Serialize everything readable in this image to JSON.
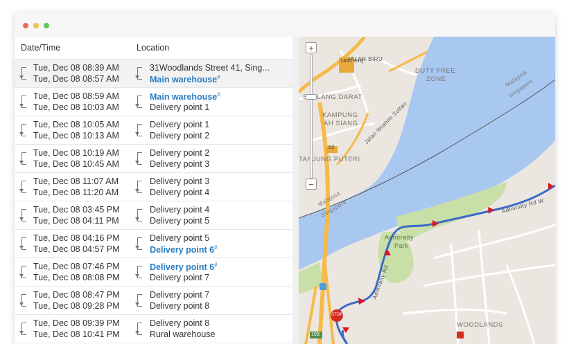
{
  "table": {
    "headers": {
      "datetime": "Date/Time",
      "location": "Location"
    },
    "rows": [
      {
        "start": "Tue, Dec 08 08:39 AM",
        "end": "Tue, Dec 08 08:57 AM",
        "from": "31Woodlands Street 41, Sing...",
        "to": "Main warehouse",
        "to_mark": "#"
      },
      {
        "start": "Tue, Dec 08 08:59 AM",
        "end": "Tue, Dec 08 10:03 AM",
        "from": "Main warehouse",
        "from_mark": "#",
        "to": "Delivery point 1"
      },
      {
        "start": "Tue, Dec 08 10:05 AM",
        "end": "Tue, Dec 08 10:13 AM",
        "from": "Delivery point 1",
        "to": "Delivery point 2"
      },
      {
        "start": "Tue, Dec 08 10:19 AM",
        "end": "Tue, Dec 08 10:45 AM",
        "from": "Delivery point 2",
        "to": "Delivery point 3"
      },
      {
        "start": "Tue, Dec 08 11:07 AM",
        "end": "Tue, Dec 08 11:20 AM",
        "from": "Delivery point 3",
        "to": "Delivery point 4"
      },
      {
        "start": "Tue, Dec 08 03:45 PM",
        "end": "Tue, Dec 08 04:11 PM",
        "from": "Delivery point 4",
        "to": "Delivery point 5"
      },
      {
        "start": "Tue, Dec 08 04:16 PM",
        "end": "Tue, Dec 08 04:57 PM",
        "from": "Delivery point 5",
        "to": "Delivery point 6",
        "to_mark": "#"
      },
      {
        "start": "Tue, Dec 08 07:46 PM",
        "end": "Tue, Dec 08 08:08 PM",
        "from": "Delivery point 6",
        "from_mark": "#",
        "to": "Delivery point 7"
      },
      {
        "start": "Tue, Dec 08 08:47 PM",
        "end": "Tue, Dec 08 09:28 PM",
        "from": "Delivery point 7",
        "to": "Delivery point 8"
      },
      {
        "start": "Tue, Dec 08 09:39 PM",
        "end": "Tue, Dec 08 10:41 PM",
        "from": "Delivery point 8",
        "to": "Rural warehouse"
      }
    ]
  },
  "map": {
    "zoom_in": "+",
    "zoom_out": "−",
    "labels": {
      "biru": "JALAN BIRU",
      "ciq": "1401 CIQ",
      "duty_free": "DUTY FREE",
      "zone": "ZONE",
      "stulang": "STULANG DARAT",
      "kampung": "KAMPUNG",
      "ahsiang": "AH SIANG",
      "ibrahim": "Jalan Ibrahim Sultan",
      "r52": "52",
      "tanjung": "TANJUNG PUTERI",
      "malaysia": "Malaysia",
      "singapore": "Singapore",
      "malaysia2": "Malaysia",
      "singapore2": "Singapore",
      "admiralty_park": "Admiralty",
      "park": "Park",
      "admiralty_rd": "Admiralty Rd",
      "admiralty_rd_w": "Admiralty Rd W",
      "woodlands": "WOODLANDS",
      "r10b": "10B",
      "stop": "STOP"
    },
    "colors": {
      "water": "#a8c8f0",
      "land": "#ebe7e0",
      "park": "#c8dfa8",
      "route": "#3b6ac6",
      "arrow": "#e0141e",
      "highway": "#f7b94a"
    }
  }
}
